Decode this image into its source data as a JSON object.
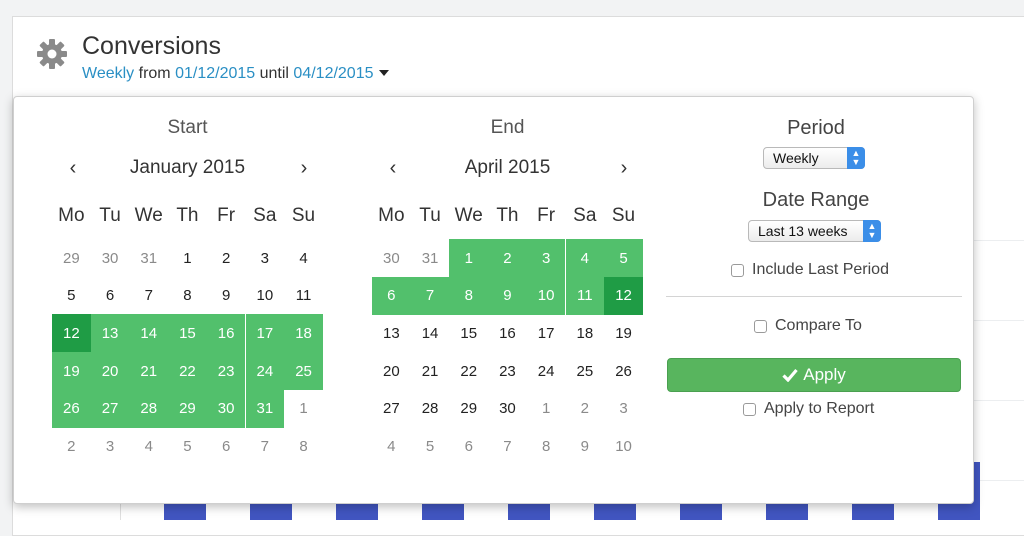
{
  "header": {
    "title": "Conversions",
    "period_link": "Weekly",
    "from_word": "from",
    "start_date": "01/12/2015",
    "until_word": "until",
    "end_date": "04/12/2015"
  },
  "picker": {
    "start": {
      "title": "Start",
      "month": "January 2015",
      "prev": "‹",
      "next": "›",
      "dow": [
        "Mo",
        "Tu",
        "We",
        "Th",
        "Fr",
        "Sa",
        "Su"
      ],
      "weeks": [
        [
          "29",
          "30",
          "31",
          "1",
          "2",
          "3",
          "4"
        ],
        [
          "5",
          "6",
          "7",
          "8",
          "9",
          "10",
          "11"
        ],
        [
          "12",
          "13",
          "14",
          "15",
          "16",
          "17",
          "18"
        ],
        [
          "19",
          "20",
          "21",
          "22",
          "23",
          "24",
          "25"
        ],
        [
          "26",
          "27",
          "28",
          "29",
          "30",
          "31",
          "1"
        ],
        [
          "2",
          "3",
          "4",
          "5",
          "6",
          "7",
          "8"
        ]
      ]
    },
    "end": {
      "title": "End",
      "month": "April 2015",
      "prev": "‹",
      "next": "›",
      "dow": [
        "Mo",
        "Tu",
        "We",
        "Th",
        "Fr",
        "Sa",
        "Su"
      ],
      "weeks": [
        [
          "30",
          "31",
          "1",
          "2",
          "3",
          "4",
          "5"
        ],
        [
          "6",
          "7",
          "8",
          "9",
          "10",
          "11",
          "12"
        ],
        [
          "13",
          "14",
          "15",
          "16",
          "17",
          "18",
          "19"
        ],
        [
          "20",
          "21",
          "22",
          "23",
          "24",
          "25",
          "26"
        ],
        [
          "27",
          "28",
          "29",
          "30",
          "1",
          "2",
          "3"
        ],
        [
          "4",
          "5",
          "6",
          "7",
          "8",
          "9",
          "10"
        ]
      ]
    },
    "period_label": "Period",
    "period_value": "Weekly",
    "range_label": "Date Range",
    "range_value": "Last 13 weeks",
    "include_last": "Include Last Period",
    "compare_to": "Compare To",
    "apply_label": "Apply",
    "apply_icon": "check-icon",
    "apply_report": "Apply to Report"
  },
  "colors": {
    "range_fill": "#52c06c",
    "range_edge": "#1f9c45",
    "link": "#2a8fc4",
    "apply_button": "#58b55e",
    "chart_bar": "#4155c0"
  }
}
